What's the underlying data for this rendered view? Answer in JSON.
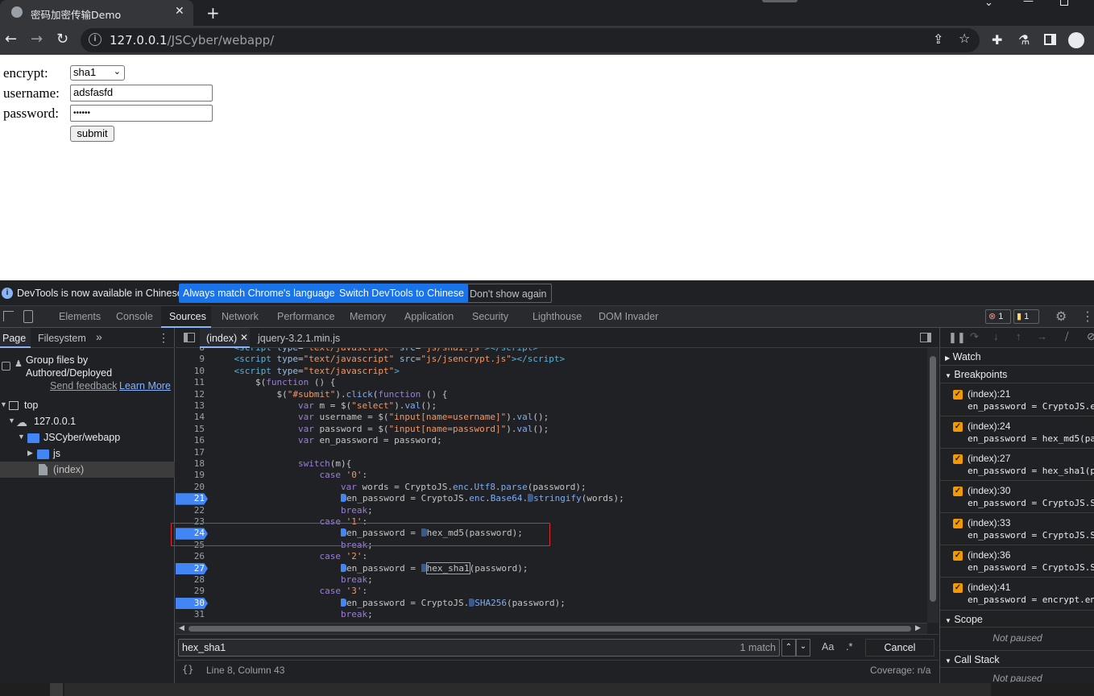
{
  "browser": {
    "tab_title": "密码加密传输Demo",
    "tab_close": "✕",
    "new_tab": "+",
    "url_host": "127.0.0.1",
    "url_path": "/JSCyber/webapp/"
  },
  "form": {
    "encrypt_label": "encrypt:",
    "encrypt_value": "sha1",
    "username_label": "username:",
    "username_value": "adsfasfd",
    "password_label": "password:",
    "password_value": "••••••",
    "submit_label": "submit"
  },
  "devtools": {
    "infobar": {
      "message": "DevTools is now available in Chinese!",
      "btn_match": "Always match Chrome's language",
      "btn_switch": "Switch DevTools to Chinese",
      "btn_dismiss": "Don't show again"
    },
    "tabs": [
      "Elements",
      "Console",
      "Sources",
      "Network",
      "Performance",
      "Memory",
      "Application",
      "Security",
      "Lighthouse",
      "DOM Invader"
    ],
    "error_count": "1",
    "warning_count": "1",
    "nav": {
      "tab_page": "Page",
      "tab_filesystem": "Filesystem",
      "group_files": "Group files by",
      "group_files_2": "Authored/Deployed",
      "send_feedback": "Send feedback",
      "learn_more": "Learn More",
      "tree": [
        "top",
        "127.0.0.1",
        "JSCyber/webapp",
        "js",
        "(index)"
      ]
    },
    "editor": {
      "file_tab_1": "(index)",
      "file_tab_2": "jquery-3.2.1.min.js",
      "search_query": "hex_sha1",
      "match_count": "1 match",
      "match_case": "Aa",
      "regex": ".*",
      "cancel": "Cancel",
      "status_position": "Line 8, Column 43",
      "coverage": "Coverage: n/a",
      "pretty_print": "{}",
      "breakpoint_lines": [
        21,
        24,
        27,
        30
      ]
    },
    "right": {
      "watch": "Watch",
      "breakpoints": "Breakpoints",
      "scope": "Scope",
      "not_paused": "Not paused",
      "call_stack": "Call Stack",
      "not_paused_2": "Not paused",
      "breakpoint_items": [
        {
          "loc": "(index):21",
          "code": "en_password = CryptoJS.e"
        },
        {
          "loc": "(index):24",
          "code": "en_password = hex_md5(pa"
        },
        {
          "loc": "(index):27",
          "code": "en_password = hex_sha1(p"
        },
        {
          "loc": "(index):30",
          "code": "en_password = CryptoJS.S"
        },
        {
          "loc": "(index):33",
          "code": "en_password = CryptoJS.S"
        },
        {
          "loc": "(index):36",
          "code": "en_password = CryptoJS.S"
        },
        {
          "loc": "(index):41",
          "code": "en_password = encrypt.en"
        }
      ]
    }
  },
  "colors": {
    "accent": "#4285f4",
    "checkbox": "#f29900",
    "highlight_box": "#e0262d",
    "info_btn": "#1a73e8"
  }
}
